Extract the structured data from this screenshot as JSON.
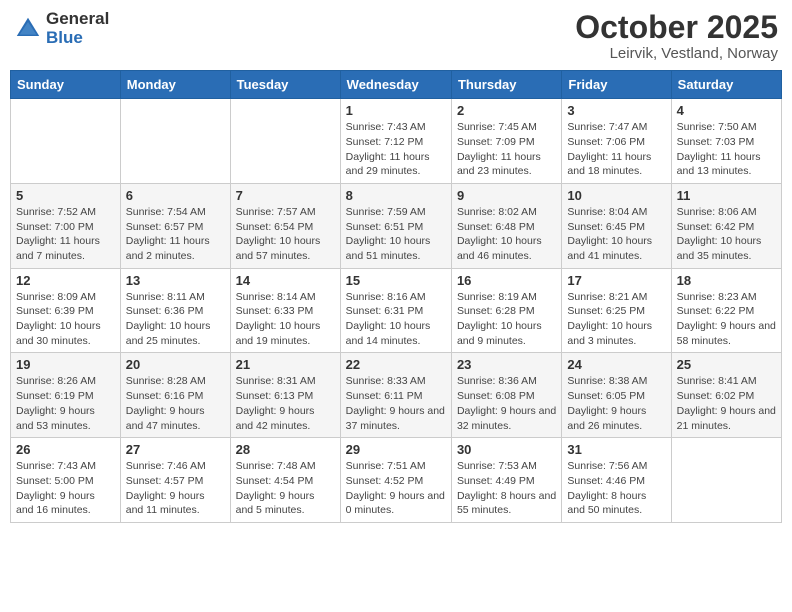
{
  "header": {
    "logo_general": "General",
    "logo_blue": "Blue",
    "month_title": "October 2025",
    "location": "Leirvik, Vestland, Norway"
  },
  "days_of_week": [
    "Sunday",
    "Monday",
    "Tuesday",
    "Wednesday",
    "Thursday",
    "Friday",
    "Saturday"
  ],
  "weeks": [
    [
      {
        "day": "",
        "info": ""
      },
      {
        "day": "",
        "info": ""
      },
      {
        "day": "",
        "info": ""
      },
      {
        "day": "1",
        "info": "Sunrise: 7:43 AM\nSunset: 7:12 PM\nDaylight: 11 hours and 29 minutes."
      },
      {
        "day": "2",
        "info": "Sunrise: 7:45 AM\nSunset: 7:09 PM\nDaylight: 11 hours and 23 minutes."
      },
      {
        "day": "3",
        "info": "Sunrise: 7:47 AM\nSunset: 7:06 PM\nDaylight: 11 hours and 18 minutes."
      },
      {
        "day": "4",
        "info": "Sunrise: 7:50 AM\nSunset: 7:03 PM\nDaylight: 11 hours and 13 minutes."
      }
    ],
    [
      {
        "day": "5",
        "info": "Sunrise: 7:52 AM\nSunset: 7:00 PM\nDaylight: 11 hours and 7 minutes."
      },
      {
        "day": "6",
        "info": "Sunrise: 7:54 AM\nSunset: 6:57 PM\nDaylight: 11 hours and 2 minutes."
      },
      {
        "day": "7",
        "info": "Sunrise: 7:57 AM\nSunset: 6:54 PM\nDaylight: 10 hours and 57 minutes."
      },
      {
        "day": "8",
        "info": "Sunrise: 7:59 AM\nSunset: 6:51 PM\nDaylight: 10 hours and 51 minutes."
      },
      {
        "day": "9",
        "info": "Sunrise: 8:02 AM\nSunset: 6:48 PM\nDaylight: 10 hours and 46 minutes."
      },
      {
        "day": "10",
        "info": "Sunrise: 8:04 AM\nSunset: 6:45 PM\nDaylight: 10 hours and 41 minutes."
      },
      {
        "day": "11",
        "info": "Sunrise: 8:06 AM\nSunset: 6:42 PM\nDaylight: 10 hours and 35 minutes."
      }
    ],
    [
      {
        "day": "12",
        "info": "Sunrise: 8:09 AM\nSunset: 6:39 PM\nDaylight: 10 hours and 30 minutes."
      },
      {
        "day": "13",
        "info": "Sunrise: 8:11 AM\nSunset: 6:36 PM\nDaylight: 10 hours and 25 minutes."
      },
      {
        "day": "14",
        "info": "Sunrise: 8:14 AM\nSunset: 6:33 PM\nDaylight: 10 hours and 19 minutes."
      },
      {
        "day": "15",
        "info": "Sunrise: 8:16 AM\nSunset: 6:31 PM\nDaylight: 10 hours and 14 minutes."
      },
      {
        "day": "16",
        "info": "Sunrise: 8:19 AM\nSunset: 6:28 PM\nDaylight: 10 hours and 9 minutes."
      },
      {
        "day": "17",
        "info": "Sunrise: 8:21 AM\nSunset: 6:25 PM\nDaylight: 10 hours and 3 minutes."
      },
      {
        "day": "18",
        "info": "Sunrise: 8:23 AM\nSunset: 6:22 PM\nDaylight: 9 hours and 58 minutes."
      }
    ],
    [
      {
        "day": "19",
        "info": "Sunrise: 8:26 AM\nSunset: 6:19 PM\nDaylight: 9 hours and 53 minutes."
      },
      {
        "day": "20",
        "info": "Sunrise: 8:28 AM\nSunset: 6:16 PM\nDaylight: 9 hours and 47 minutes."
      },
      {
        "day": "21",
        "info": "Sunrise: 8:31 AM\nSunset: 6:13 PM\nDaylight: 9 hours and 42 minutes."
      },
      {
        "day": "22",
        "info": "Sunrise: 8:33 AM\nSunset: 6:11 PM\nDaylight: 9 hours and 37 minutes."
      },
      {
        "day": "23",
        "info": "Sunrise: 8:36 AM\nSunset: 6:08 PM\nDaylight: 9 hours and 32 minutes."
      },
      {
        "day": "24",
        "info": "Sunrise: 8:38 AM\nSunset: 6:05 PM\nDaylight: 9 hours and 26 minutes."
      },
      {
        "day": "25",
        "info": "Sunrise: 8:41 AM\nSunset: 6:02 PM\nDaylight: 9 hours and 21 minutes."
      }
    ],
    [
      {
        "day": "26",
        "info": "Sunrise: 7:43 AM\nSunset: 5:00 PM\nDaylight: 9 hours and 16 minutes."
      },
      {
        "day": "27",
        "info": "Sunrise: 7:46 AM\nSunset: 4:57 PM\nDaylight: 9 hours and 11 minutes."
      },
      {
        "day": "28",
        "info": "Sunrise: 7:48 AM\nSunset: 4:54 PM\nDaylight: 9 hours and 5 minutes."
      },
      {
        "day": "29",
        "info": "Sunrise: 7:51 AM\nSunset: 4:52 PM\nDaylight: 9 hours and 0 minutes."
      },
      {
        "day": "30",
        "info": "Sunrise: 7:53 AM\nSunset: 4:49 PM\nDaylight: 8 hours and 55 minutes."
      },
      {
        "day": "31",
        "info": "Sunrise: 7:56 AM\nSunset: 4:46 PM\nDaylight: 8 hours and 50 minutes."
      },
      {
        "day": "",
        "info": ""
      }
    ]
  ]
}
